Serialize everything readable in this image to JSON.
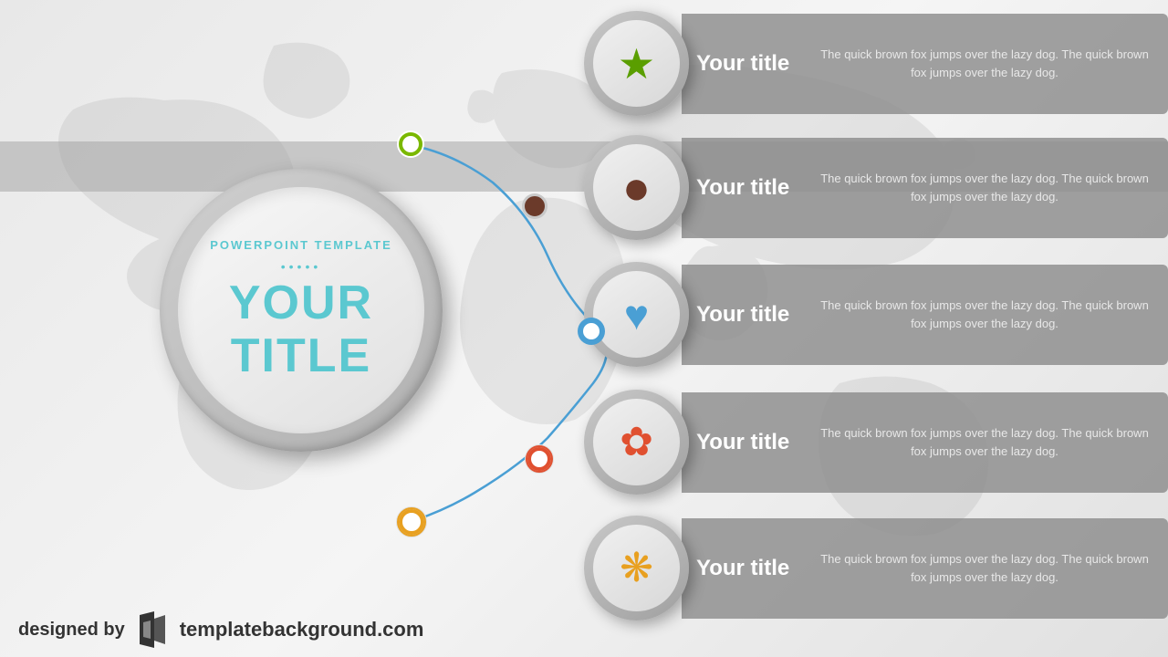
{
  "template": {
    "subtitle": "POWERPOINT TEMPLATE",
    "dots": "•••••",
    "title_line1": "YOUR",
    "title_line2": "TITLE",
    "background_color": "#e8e8e8",
    "accent_color": "#5bc8d0"
  },
  "items": [
    {
      "id": 1,
      "title": "Your title",
      "icon": "★",
      "icon_color": "#5a9e00",
      "desc": "The quick brown fox jumps over the lazy dog. The quick brown fox jumps over the lazy dog.",
      "dot_color": "#7ab800",
      "dot_border": "#7ab800"
    },
    {
      "id": 2,
      "title": "Your title",
      "icon": "●",
      "icon_color": "#6b3a2a",
      "desc": "The quick brown fox jumps over the lazy dog. The quick brown fox jumps over the lazy dog.",
      "dot_color": "#6b3a2a",
      "dot_border": "#6b3a2a"
    },
    {
      "id": 3,
      "title": "Your title",
      "icon": "♥",
      "icon_color": "#4a9fd4",
      "desc": "The quick brown fox jumps over the lazy dog. The quick brown fox jumps over the lazy dog.",
      "dot_color": "#4a9fd4",
      "dot_border": "#4a9fd4"
    },
    {
      "id": 4,
      "title": "Your title",
      "icon": "✿",
      "icon_color": "#e05030",
      "desc": "The quick brown fox jumps over the lazy dog. The quick brown fox jumps over the lazy dog.",
      "dot_color": "#e05030",
      "dot_border": "#e05030"
    },
    {
      "id": 5,
      "title": "Your title",
      "icon": "❋",
      "icon_color": "#e8a020",
      "desc": "The quick brown fox jumps over the lazy dog. The quick brown fox jumps over the lazy dog.",
      "dot_color": "#e8a020",
      "dot_border": "#e8a020"
    }
  ],
  "footer": {
    "designed_by": "designed by",
    "url": "templatebackground.com"
  }
}
